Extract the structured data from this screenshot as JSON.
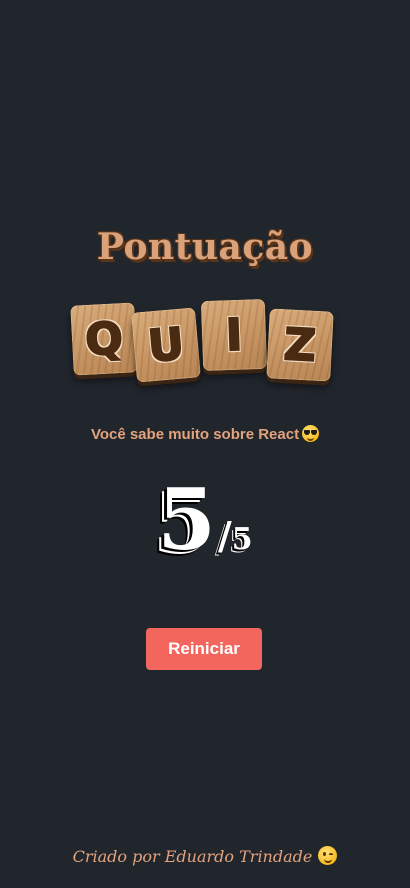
{
  "screen": {
    "title": "Pontuação",
    "logo": {
      "letters": [
        "Q",
        "U",
        "I",
        "Z"
      ],
      "tile_color": "#c79563",
      "letter_color": "#4b2a12"
    },
    "message": "Você sabe muito sobre React",
    "message_emoji": "smiling-face-with-sunglasses",
    "score": {
      "value": "5",
      "separator": "/",
      "total": "5"
    },
    "restart_button": {
      "label": "Reiniciar",
      "color": "#f2665e"
    },
    "footer": {
      "credit": "Criado por Eduardo Trindade",
      "emoji": "winking-face"
    }
  },
  "colors": {
    "background": "#21262d",
    "accent_text": "#e3a37d",
    "title": "#d9a27a"
  }
}
